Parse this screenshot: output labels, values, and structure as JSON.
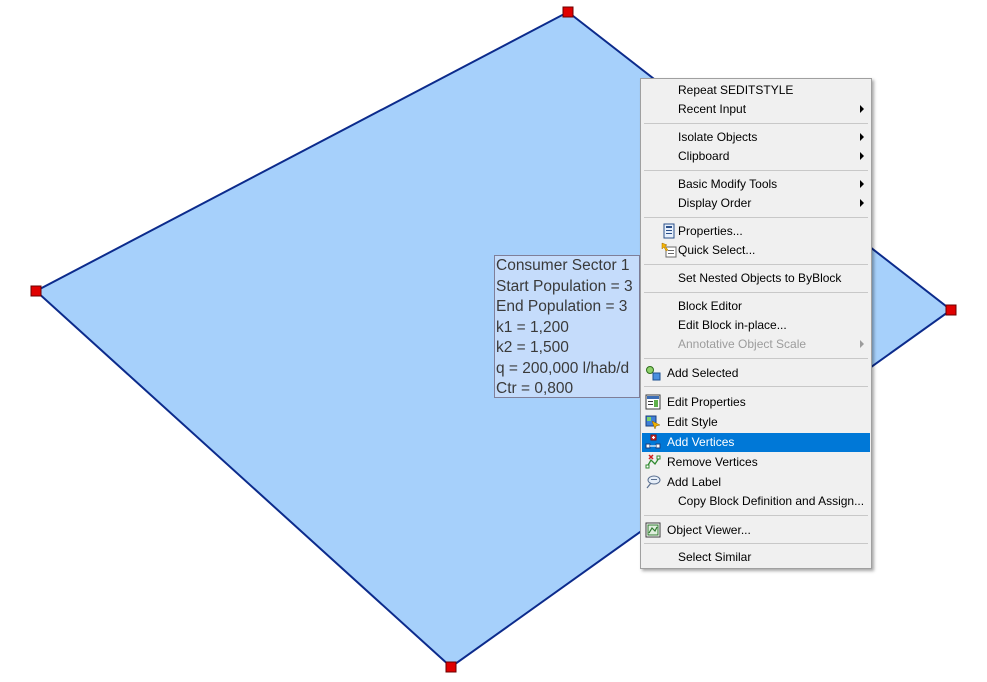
{
  "drawing": {
    "fill_color": "#a6d0fb",
    "outline_color": "#0c2b8c",
    "grip_color": "#e00000",
    "text_color": "#3a3a3a",
    "label_lines": [
      "Consumer Sector 1",
      "Start Population = 3",
      "End Population = 3",
      "k1 = 1,200",
      "k2 = 1,500",
      "q = 200,000 l/hab/d",
      "Ctr = 0,800"
    ]
  },
  "context_menu": {
    "highlight_color": "#0078d7",
    "items": [
      {
        "label": "Repeat SEDITSTYLE"
      },
      {
        "label": "Recent Input",
        "submenu": true
      },
      {
        "label": "Isolate Objects",
        "submenu": true
      },
      {
        "label": "Clipboard",
        "submenu": true
      },
      {
        "label": "Basic Modify Tools",
        "submenu": true
      },
      {
        "label": "Display Order",
        "submenu": true
      },
      {
        "label": "Properties...",
        "icon": "properties-icon"
      },
      {
        "label": "Quick Select...",
        "icon": "quick-select-icon"
      },
      {
        "label": "Set Nested Objects to ByBlock"
      },
      {
        "label": "Block Editor"
      },
      {
        "label": "Edit Block in-place..."
      },
      {
        "label": "Annotative Object Scale",
        "submenu": true,
        "disabled": true
      },
      {
        "label": "Add Selected",
        "icon": "add-selected-icon"
      },
      {
        "label": "Edit Properties",
        "icon": "edit-properties-icon"
      },
      {
        "label": "Edit Style",
        "icon": "edit-style-icon"
      },
      {
        "label": "Add Vertices",
        "icon": "add-vertices-icon",
        "highlighted": true
      },
      {
        "label": "Remove Vertices",
        "icon": "remove-vertices-icon"
      },
      {
        "label": "Add Label",
        "icon": "add-label-icon"
      },
      {
        "label": "Copy Block Definition and Assign..."
      },
      {
        "label": "Object Viewer...",
        "icon": "object-viewer-icon"
      },
      {
        "label": "Select Similar"
      }
    ]
  }
}
